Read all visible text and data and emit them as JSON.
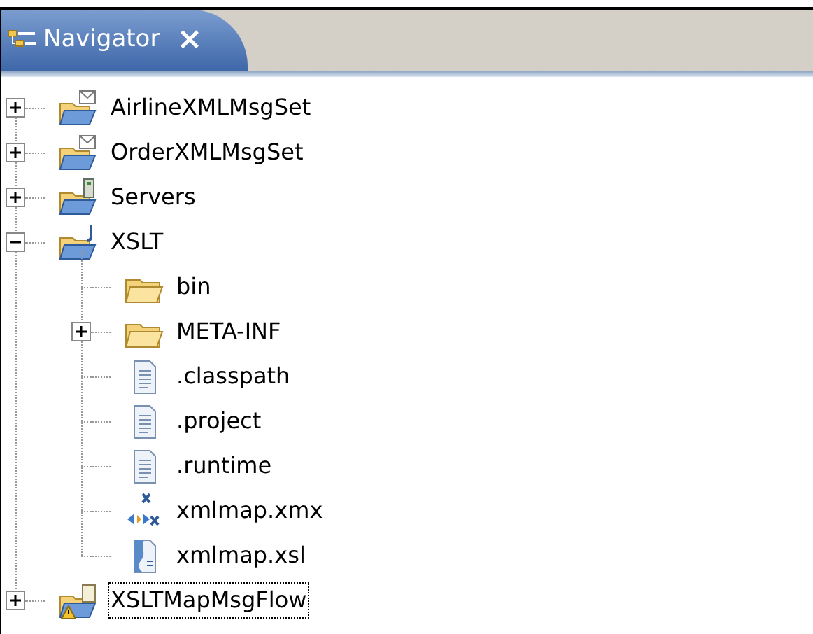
{
  "view_tab": {
    "title": "Navigator",
    "selected": true,
    "close": "×"
  },
  "tree": [
    {
      "label": "AirlineXMLMsgSet",
      "kind": "msgset",
      "expanded": false,
      "selected": false
    },
    {
      "label": "OrderXMLMsgSet",
      "kind": "msgset",
      "expanded": false,
      "selected": false
    },
    {
      "label": "Servers",
      "kind": "servers",
      "expanded": false,
      "selected": false
    },
    {
      "label": "XSLT",
      "kind": "java",
      "expanded": true,
      "selected": false,
      "children": [
        {
          "label": "bin",
          "kind": "folder",
          "selected": false
        },
        {
          "label": "META-INF",
          "kind": "folder",
          "expanded": false,
          "selected": false
        },
        {
          "label": ".classpath",
          "kind": "file",
          "selected": false
        },
        {
          "label": ".project",
          "kind": "file",
          "selected": false
        },
        {
          "label": ".runtime",
          "kind": "file",
          "selected": false
        },
        {
          "label": "xmlmap.xmx",
          "kind": "xmx",
          "selected": false
        },
        {
          "label": "xmlmap.xsl",
          "kind": "xsl",
          "selected": false
        }
      ]
    },
    {
      "label": "XSLTMapMsgFlow",
      "kind": "flow",
      "expanded": false,
      "selected": true
    }
  ]
}
